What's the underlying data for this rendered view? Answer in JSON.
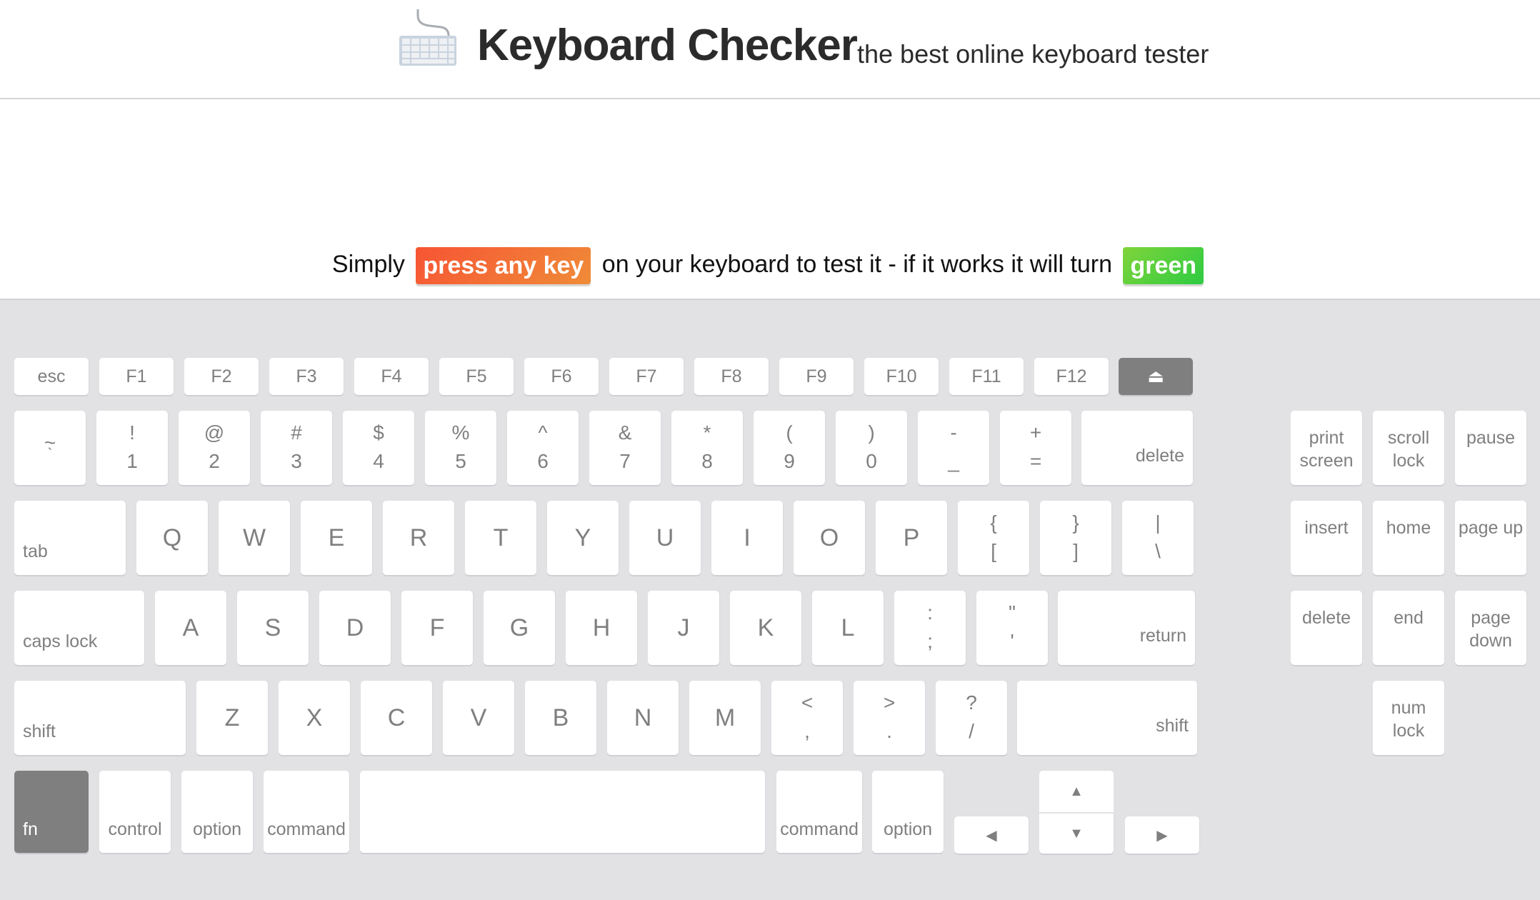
{
  "header": {
    "logo_icon": "keyboard-icon",
    "title": "Keyboard Checker",
    "subtitle": "the best online keyboard tester"
  },
  "instruction": {
    "prefix": "Simply",
    "highlight": "press any key",
    "middle": "on your keyboard to test it - if it works it will turn",
    "success": "green",
    "colors": {
      "highlight_start": "#f75434",
      "highlight_end": "#ef8c38",
      "success_start": "#80d43a",
      "success_end": "#2ecb42"
    }
  },
  "keys": {
    "esc": "esc",
    "f": [
      "F1",
      "F2",
      "F3",
      "F4",
      "F5",
      "F6",
      "F7",
      "F8",
      "F9",
      "F10",
      "F11",
      "F12"
    ],
    "eject": "⏏",
    "number_row": [
      {
        "top": "~",
        "bot": "`"
      },
      {
        "top": "!",
        "bot": "1"
      },
      {
        "top": "@",
        "bot": "2"
      },
      {
        "top": "#",
        "bot": "3"
      },
      {
        "top": "$",
        "bot": "4"
      },
      {
        "top": "%",
        "bot": "5"
      },
      {
        "top": "^",
        "bot": "6"
      },
      {
        "top": "&",
        "bot": "7"
      },
      {
        "top": "*",
        "bot": "8"
      },
      {
        "top": "(",
        "bot": "9"
      },
      {
        "top": ")",
        "bot": "0"
      },
      {
        "top": "-",
        "bot": "_"
      },
      {
        "top": "+",
        "bot": "="
      }
    ],
    "backspace": "delete",
    "tab": "tab",
    "qrow": [
      "Q",
      "W",
      "E",
      "R",
      "T",
      "Y",
      "U",
      "I",
      "O",
      "P"
    ],
    "qrow_sym": [
      {
        "top": "{",
        "bot": "["
      },
      {
        "top": "}",
        "bot": "]"
      },
      {
        "top": "|",
        "bot": "\\"
      }
    ],
    "caps": "caps lock",
    "arow": [
      "A",
      "S",
      "D",
      "F",
      "G",
      "H",
      "J",
      "K",
      "L"
    ],
    "arow_sym": [
      {
        "top": ":",
        "bot": ";"
      },
      {
        "top": "\"",
        "bot": "'"
      }
    ],
    "return": "return",
    "shift_left": "shift",
    "zrow": [
      "Z",
      "X",
      "C",
      "V",
      "B",
      "N",
      "M"
    ],
    "zrow_sym": [
      {
        "top": "<",
        "bot": ","
      },
      {
        "top": ">",
        "bot": "."
      },
      {
        "top": "?",
        "bot": "/"
      }
    ],
    "shift_right": "shift",
    "fn": "fn",
    "control": "control",
    "option_left": "option",
    "command_left": "command",
    "space": "",
    "command_right": "command",
    "option_right": "option",
    "arrows": {
      "left": "◀",
      "up": "▲",
      "down": "▼",
      "right": "▶"
    },
    "nav": {
      "print_screen": "print screen",
      "scroll_lock": "scroll lock",
      "pause": "pause",
      "insert": "insert",
      "home": "home",
      "page_up": "page up",
      "delete": "delete",
      "end": "end",
      "page_down": "page down",
      "num_lock": "num lock"
    }
  },
  "pressed_keys": [
    "fn",
    "eject"
  ]
}
